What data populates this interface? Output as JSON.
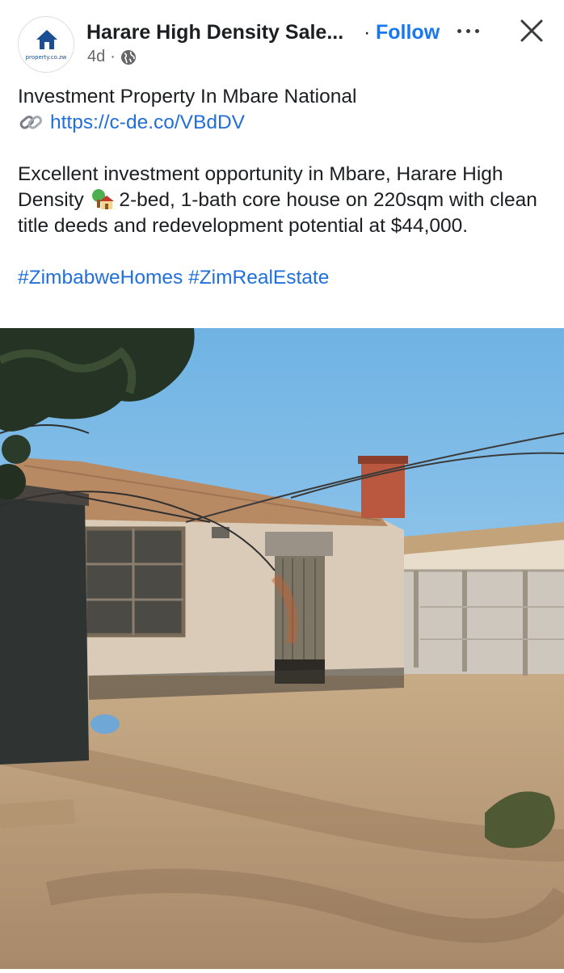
{
  "post": {
    "page_name": "Harare High Density Sale...",
    "separator": "·",
    "follow_label": "Follow",
    "time": "4d",
    "meta_separator": "·",
    "avatar_text": "property.co.zw",
    "title": "Investment Property In Mbare National",
    "link": "https://c-de.co/VBdDV",
    "description_1": "Excellent investment opportunity in Mbare, Harare High Density",
    "description_2": "2-bed, 1-bath core house on 220sqm with clean title deeds and redevelopment potential at $44,000.",
    "hashtags": [
      "#ZimbabweHomes",
      "#ZimRealEstate"
    ]
  },
  "icons": {
    "more": "more-options-icon",
    "close": "close-icon",
    "audience": "globe-icon",
    "link": "link-icon",
    "house": "house-with-garden-emoji"
  },
  "colors": {
    "link": "#216fdb",
    "follow": "#1877f2",
    "brand": "#1a4f93"
  }
}
